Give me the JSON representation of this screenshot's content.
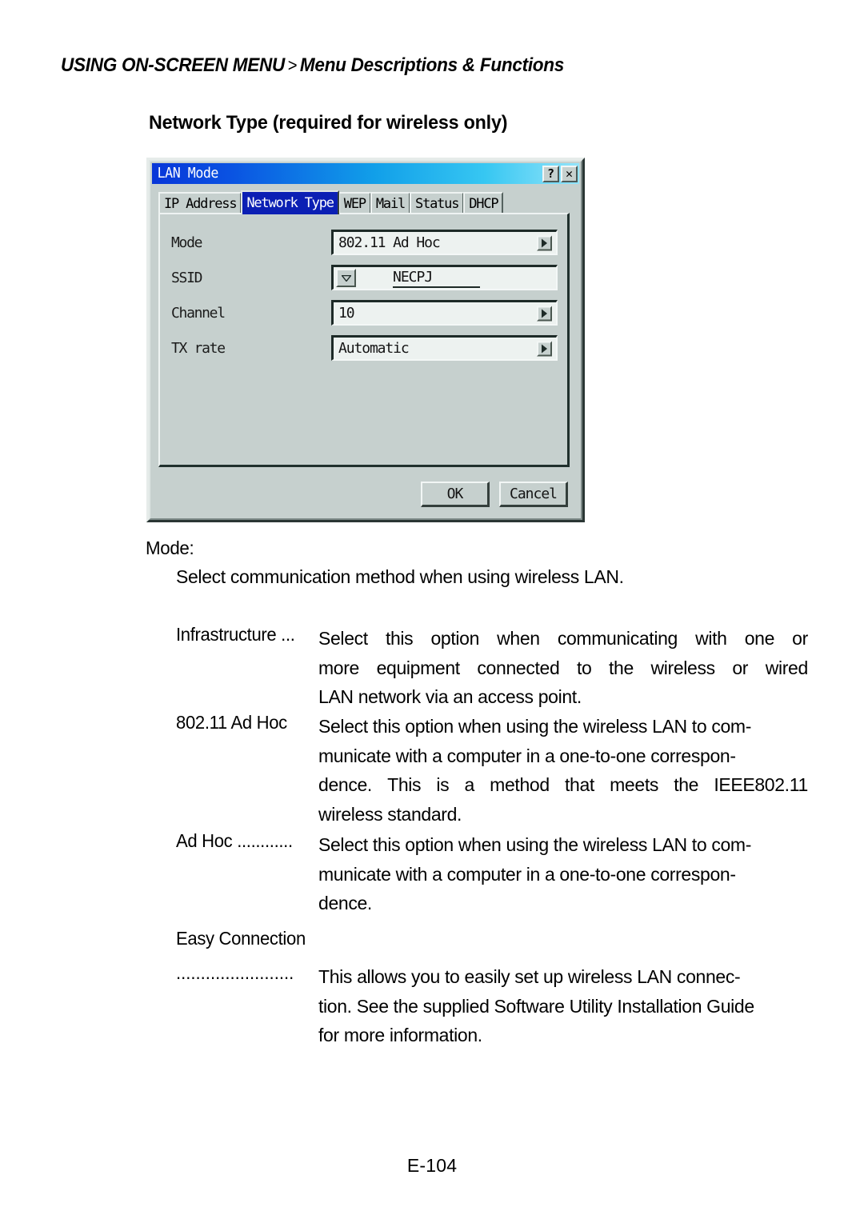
{
  "header": {
    "left": "USING ON-SCREEN MENU",
    "separator": ">",
    "right": "Menu Descriptions & Functions"
  },
  "section_title": "Network Type (required for wireless only)",
  "dialog": {
    "title": "LAN Mode",
    "help_button": "?",
    "close_button": "✕",
    "tabs": [
      {
        "label": "IP Address",
        "selected": false
      },
      {
        "label": "Network Type",
        "selected": true
      },
      {
        "label": "WEP",
        "selected": false
      },
      {
        "label": "Mail",
        "selected": false
      },
      {
        "label": "Status",
        "selected": false
      },
      {
        "label": "DHCP",
        "selected": false
      }
    ],
    "fields": [
      {
        "label": "Mode",
        "value": "802.11 Ad Hoc",
        "control": "dropdown"
      },
      {
        "label": "SSID",
        "value": "NECPJ",
        "control": "combo-edit"
      },
      {
        "label": "Channel",
        "value": "10",
        "control": "dropdown"
      },
      {
        "label": "TX rate",
        "value": "Automatic",
        "control": "dropdown"
      }
    ],
    "buttons": {
      "ok": "OK",
      "cancel": "Cancel"
    },
    "colors": {
      "face": "#c6d0ce",
      "title_start": "#0836d8",
      "title_end": "#93e4fa",
      "tab_selected": "#0b1fb4"
    }
  },
  "body": {
    "mode_heading": "Mode:",
    "mode_description": "Select communication method when using wireless LAN.",
    "definitions": [
      {
        "term": "Infrastructure ...",
        "lines": [
          "Select  this  option  when  communicating  with  one  or",
          "more  equipment  connected  to  the  wireless  or  wired",
          "LAN network via an access point."
        ],
        "justified": [
          true,
          true,
          false
        ]
      },
      {
        "term": "802.11 Ad Hoc",
        "lines": [
          "Select this option when using the wireless LAN to com-",
          "municate with a computer in a one-to-one correspon-",
          "dence. This  is  a  method  that  meets  the  IEEE802.11",
          "wireless standard."
        ],
        "justified": [
          false,
          false,
          true,
          false
        ]
      },
      {
        "term": "Ad Hoc ............",
        "lines": [
          "Select this option when using the wireless LAN to com-",
          "municate with a computer in a one-to-one correspon-",
          "dence."
        ],
        "justified": [
          false,
          false,
          false
        ]
      },
      {
        "term": "Easy Connection",
        "term_on_own_line": true,
        "continuation_term": "........................",
        "lines": [
          "This allows you to easily set up wireless LAN connec-",
          "tion. See the supplied Software Utility Installation Guide",
          "for more information."
        ],
        "justified": [
          false,
          false,
          false
        ]
      }
    ]
  },
  "page_number": "E-104"
}
